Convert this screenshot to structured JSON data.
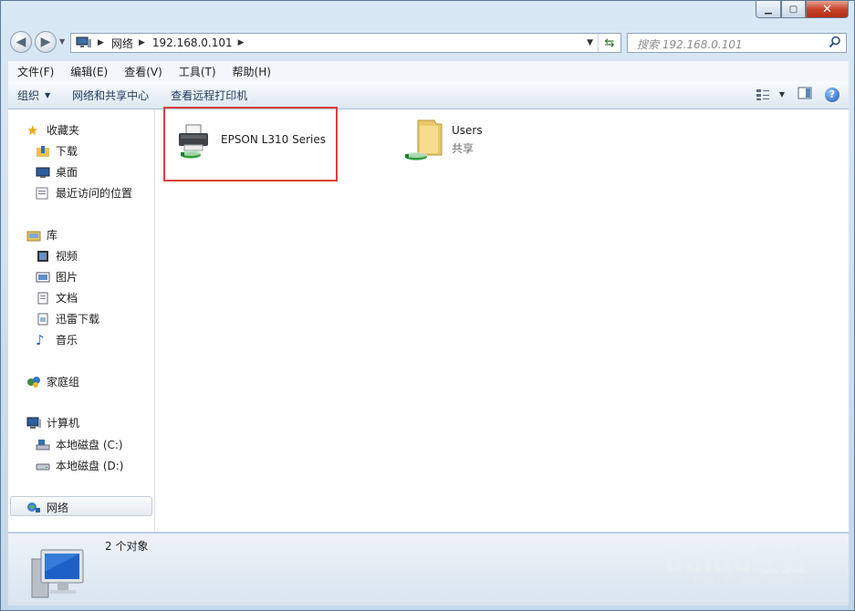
{
  "window": {
    "caption_buttons": {
      "minimize": "▁",
      "maximize": "▢",
      "close": "✕"
    }
  },
  "address_bar": {
    "crumbs": [
      "网络",
      "192.168.0.101"
    ],
    "search_placeholder": "搜索 192.168.0.101"
  },
  "menubar": {
    "items": [
      "文件(F)",
      "编辑(E)",
      "查看(V)",
      "工具(T)",
      "帮助(H)"
    ]
  },
  "toolbar": {
    "organize": "组织",
    "network_center": "网络和共享中心",
    "view_printers": "查看远程打印机"
  },
  "nav_pane": {
    "favorites": "收藏夹",
    "downloads": "下载",
    "desktop": "桌面",
    "recent": "最近访问的位置",
    "libraries": "库",
    "videos": "视频",
    "pictures": "图片",
    "documents": "文档",
    "thunder": "迅雷下载",
    "music": "音乐",
    "homegroup": "家庭组",
    "computer": "计算机",
    "drive_c": "本地磁盘 (C:)",
    "drive_d": "本地磁盘 (D:)",
    "network": "网络"
  },
  "items": [
    {
      "name": "EPSON L310 Series",
      "icon": "printer-icon"
    },
    {
      "name": "Users",
      "sub": "共享",
      "icon": "shared-folder-icon"
    }
  ],
  "status": {
    "count_text": "2 个对象"
  },
  "watermark": {
    "brand": "Baidu经验",
    "url": "jingyan.baidu.com"
  }
}
